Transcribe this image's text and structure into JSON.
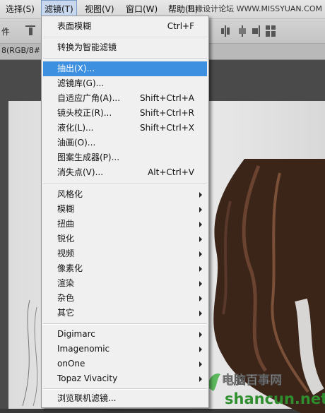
{
  "menubar": {
    "items": [
      {
        "label": "选择(S)"
      },
      {
        "label": "滤镜(T)"
      },
      {
        "label": "视图(V)"
      },
      {
        "label": "窗口(W)"
      },
      {
        "label": "帮助(H)"
      }
    ],
    "site_text": "思缘设计论坛 WWW.MISSYUAN.COM"
  },
  "toolbar": {
    "left_text": "件"
  },
  "document": {
    "tab_text": "8(RGB/8#)"
  },
  "filter_menu": {
    "items": [
      {
        "label": "表面模糊",
        "shortcut": "Ctrl+F"
      },
      {
        "label": "转换为智能滤镜",
        "shortcut": ""
      },
      {
        "label": "抽出(X)...",
        "shortcut": ""
      },
      {
        "label": "滤镜库(G)...",
        "shortcut": ""
      },
      {
        "label": "自适应广角(A)...",
        "shortcut": "Shift+Ctrl+A"
      },
      {
        "label": "镜头校正(R)...",
        "shortcut": "Shift+Ctrl+R"
      },
      {
        "label": "液化(L)...",
        "shortcut": "Shift+Ctrl+X"
      },
      {
        "label": "油画(O)...",
        "shortcut": ""
      },
      {
        "label": "图案生成器(P)...",
        "shortcut": ""
      },
      {
        "label": "消失点(V)...",
        "shortcut": "Alt+Ctrl+V"
      },
      {
        "label": "风格化",
        "shortcut": ""
      },
      {
        "label": "模糊",
        "shortcut": ""
      },
      {
        "label": "扭曲",
        "shortcut": ""
      },
      {
        "label": "锐化",
        "shortcut": ""
      },
      {
        "label": "视频",
        "shortcut": ""
      },
      {
        "label": "像素化",
        "shortcut": ""
      },
      {
        "label": "渲染",
        "shortcut": ""
      },
      {
        "label": "杂色",
        "shortcut": ""
      },
      {
        "label": "其它",
        "shortcut": ""
      },
      {
        "label": "Digimarc",
        "shortcut": ""
      },
      {
        "label": "Imagenomic",
        "shortcut": ""
      },
      {
        "label": "onOne",
        "shortcut": ""
      },
      {
        "label": "Topaz Vivacity",
        "shortcut": ""
      },
      {
        "label": "浏览联机滤镜...",
        "shortcut": ""
      }
    ]
  },
  "watermark": {
    "brand": "电脑百事网",
    "url": "shancun.net"
  },
  "colors": {
    "highlight": "#3d90e0",
    "menu_bg": "#f0f0f0"
  }
}
